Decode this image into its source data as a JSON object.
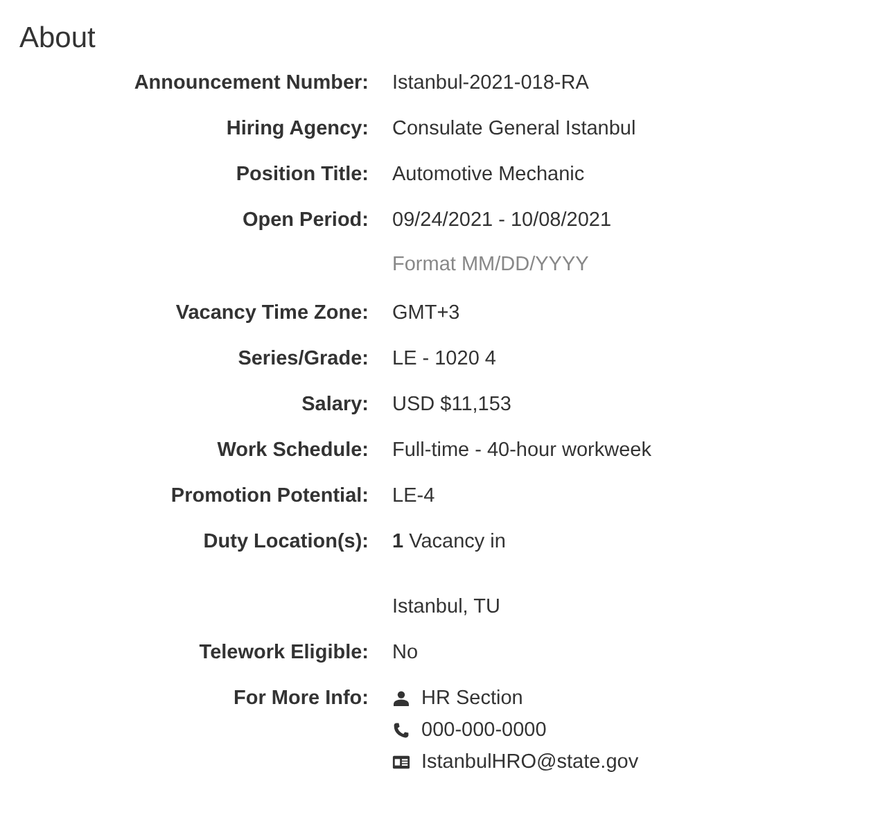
{
  "heading": "About",
  "rows": [
    {
      "label": "Announcement Number:",
      "kind": "text",
      "lines": [
        {
          "kind": "value",
          "text": "Istanbul-2021-018-RA"
        }
      ]
    },
    {
      "label": "Hiring Agency:",
      "kind": "text",
      "lines": [
        {
          "kind": "value",
          "text": "Consulate General Istanbul"
        }
      ]
    },
    {
      "label": "Position Title:",
      "kind": "text",
      "lines": [
        {
          "kind": "value",
          "text": "Automotive Mechanic"
        }
      ]
    },
    {
      "label": "Open Period:",
      "kind": "text",
      "lines": [
        {
          "kind": "value",
          "text": "09/24/2021 - 10/08/2021"
        },
        {
          "kind": "hint",
          "text": "Format MM/DD/YYYY"
        }
      ]
    },
    {
      "label": "Vacancy Time Zone:",
      "kind": "text",
      "lines": [
        {
          "kind": "value",
          "text": "GMT+3"
        }
      ]
    },
    {
      "label": "Series/Grade:",
      "kind": "text",
      "lines": [
        {
          "kind": "value",
          "text": "LE - 1020 4"
        }
      ]
    },
    {
      "label": "Salary:",
      "kind": "text",
      "lines": [
        {
          "kind": "value",
          "text": "USD $11,153"
        }
      ]
    },
    {
      "label": "Work Schedule:",
      "kind": "text",
      "lines": [
        {
          "kind": "value",
          "text": "Full-time - 40-hour workweek"
        }
      ]
    },
    {
      "label": "Promotion Potential:",
      "kind": "text",
      "lines": [
        {
          "kind": "value",
          "text": "LE-4"
        }
      ]
    },
    {
      "label": "Duty Location(s):",
      "kind": "text",
      "lines": [
        {
          "kind": "value",
          "text": "**1** Vacancy in"
        },
        {
          "kind": "place",
          "text": "Istanbul, TU"
        }
      ]
    },
    {
      "label": "Telework Eligible:",
      "kind": "text",
      "lines": [
        {
          "kind": "value",
          "text": "No"
        }
      ]
    },
    {
      "label": "For More Info:",
      "kind": "contacts",
      "contacts": [
        {
          "kind": "person",
          "text": "HR Section"
        },
        {
          "kind": "phone",
          "text": "000-000-0000"
        },
        {
          "kind": "email",
          "text": "IstanbulHRO@state.gov"
        }
      ]
    }
  ]
}
